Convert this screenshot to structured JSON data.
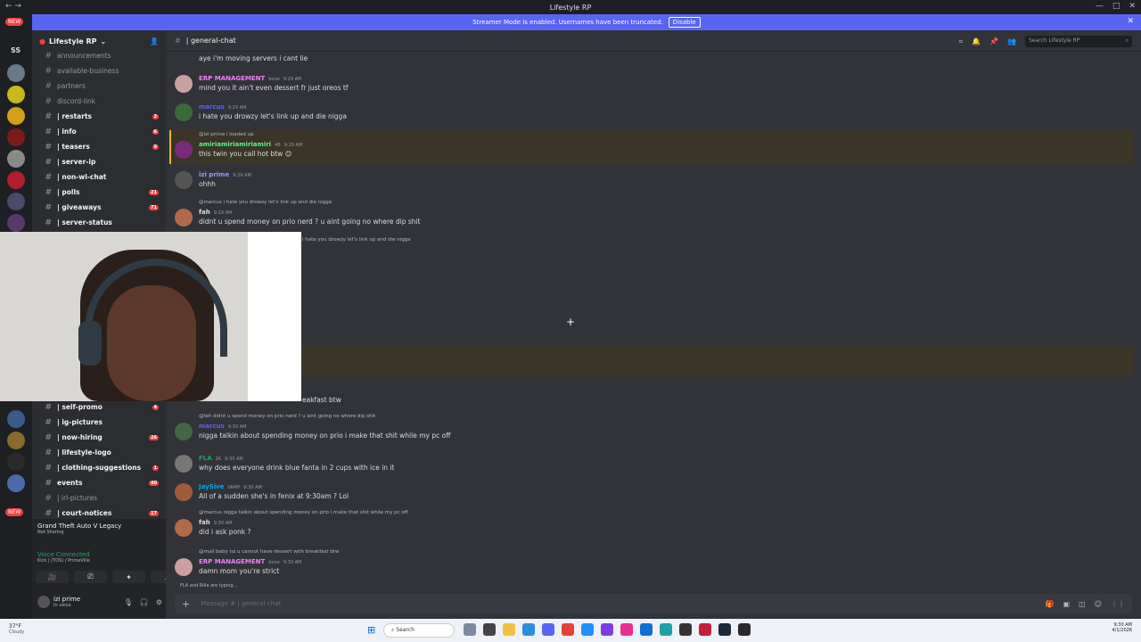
{
  "window": {
    "title": "Lifestyle RP"
  },
  "streamer": {
    "text": "Streamer Mode is enabled. Usernames have been truncated.",
    "button": "Disable"
  },
  "guilds": {
    "ss_label": "SS",
    "new_label": "NEW"
  },
  "server": {
    "name": "Lifestyle RP"
  },
  "channels": [
    {
      "name": "announcements",
      "unread": false,
      "count": ""
    },
    {
      "name": "available-business",
      "unread": false,
      "count": ""
    },
    {
      "name": "partners",
      "unread": false,
      "count": ""
    },
    {
      "name": "discord-link",
      "unread": false,
      "count": ""
    },
    {
      "name": "| restarts",
      "unread": true,
      "count": "3"
    },
    {
      "name": "| info",
      "unread": true,
      "count": "6"
    },
    {
      "name": "| teasers",
      "unread": true,
      "count": "9"
    },
    {
      "name": "| server-ip",
      "unread": true,
      "count": ""
    },
    {
      "name": "| non-wl-chat",
      "unread": true,
      "count": ""
    },
    {
      "name": "| polls",
      "unread": true,
      "count": "21"
    },
    {
      "name": "| giveaways",
      "unread": true,
      "count": "71"
    },
    {
      "name": "| server-status",
      "unread": true,
      "count": ""
    }
  ],
  "channels_lower": [
    {
      "name": "| self-promo",
      "unread": true,
      "count": "4"
    },
    {
      "name": "| ig-pictures",
      "unread": true,
      "count": ""
    },
    {
      "name": "| now-hiring",
      "unread": true,
      "count": "26"
    },
    {
      "name": "| lifestyle-logo",
      "unread": true,
      "count": ""
    },
    {
      "name": "| clothing-suggestions",
      "unread": true,
      "count": "1"
    },
    {
      "name": "events",
      "unread": true,
      "count": "40"
    },
    {
      "name": "| irl-pictures",
      "unread": false,
      "count": ""
    },
    {
      "name": "| court-notices",
      "unread": true,
      "count": "17"
    }
  ],
  "activity": {
    "game": "Grand Theft Auto V Legacy",
    "status": "Not Sharing"
  },
  "voice": {
    "status": "Voice Connected",
    "channel": "Kick | (TOS) / PrimeVille"
  },
  "user": {
    "name": "izi prime",
    "status": "In voice"
  },
  "channel_header": {
    "name": "| general-chat",
    "search_placeholder": "Search Lifestyle RP"
  },
  "messages": [
    {
      "text": "aye i'm moving servers i cant lie"
    },
    {
      "author": "ERP MANAGEMENT",
      "tag": "bone",
      "time": "9:29 AM",
      "text": "mind you it ain't even dessert fr just oreos tf",
      "color": "#f47fff"
    },
    {
      "author": "marcus",
      "time": "9:29 AM",
      "text": "i hate you drowzy let's link up and die nigga",
      "color": "#5865f2"
    },
    {
      "reply": "@izi prime  i loaded up",
      "author": "amiriamiriamiriamiri",
      "tag": "4B",
      "time": "9:29 AM",
      "text": "this twin you call hot btw 😊",
      "color": "#57f287"
    },
    {
      "author": "izi prime",
      "time": "9:29 AM",
      "text": "ohhh",
      "color": "#949cf7"
    },
    {
      "reply": "@marcus  i hate you drowzy let's link up and die nigga",
      "author": "fah",
      "time": "9:29 AM",
      "text": "didnt u spend money on prio nerd ? u aint going no where dip shit",
      "color": "#dbdee1"
    },
    {
      "partial": "i hate you drowzy let's link up and die nigga"
    },
    {
      "partial": "eakfast btw"
    },
    {
      "reply": "@fah  didnt u spend money on prio nerd ? u aint going no where dip shit",
      "author": "marcus",
      "time": "9:30 AM",
      "text": "nigga talkin about spending money on prio i make that shit while my pc off",
      "color": "#5865f2"
    },
    {
      "author": "FLA",
      "tag": "2K",
      "time": "9:30 AM",
      "text": "why does everyone drink blue fanta in 2 cups with ice in it",
      "color": "#23a55a"
    },
    {
      "author": "JaySive",
      "tag": "VAMP",
      "time": "9:30 AM",
      "text": "All of a sudden she's in fenix at 9:30am ? Lol",
      "color": "#00a8fc"
    },
    {
      "reply": "@marcus  nigga talkin about spending money on prio i make that shit while my pc off",
      "author": "fah",
      "time": "9:30 AM",
      "text": "did i ask ponk ?",
      "color": "#dbdee1"
    },
    {
      "reply": "@mall  baby  no u cannot have dessert with breakfast btw",
      "author": "ERP MANAGEMENT",
      "tag": "bone",
      "time": "9:30 AM",
      "text": "damn mom you're strict",
      "color": "#f47fff"
    }
  ],
  "typing": "FLA and Rilla are typing...",
  "composer": {
    "placeholder": "Message # | general-chat"
  },
  "taskbar": {
    "temp": "37°F",
    "weather": "Cloudy",
    "search": "Search",
    "time": "9:30 AM",
    "date": "4/1/2026"
  }
}
